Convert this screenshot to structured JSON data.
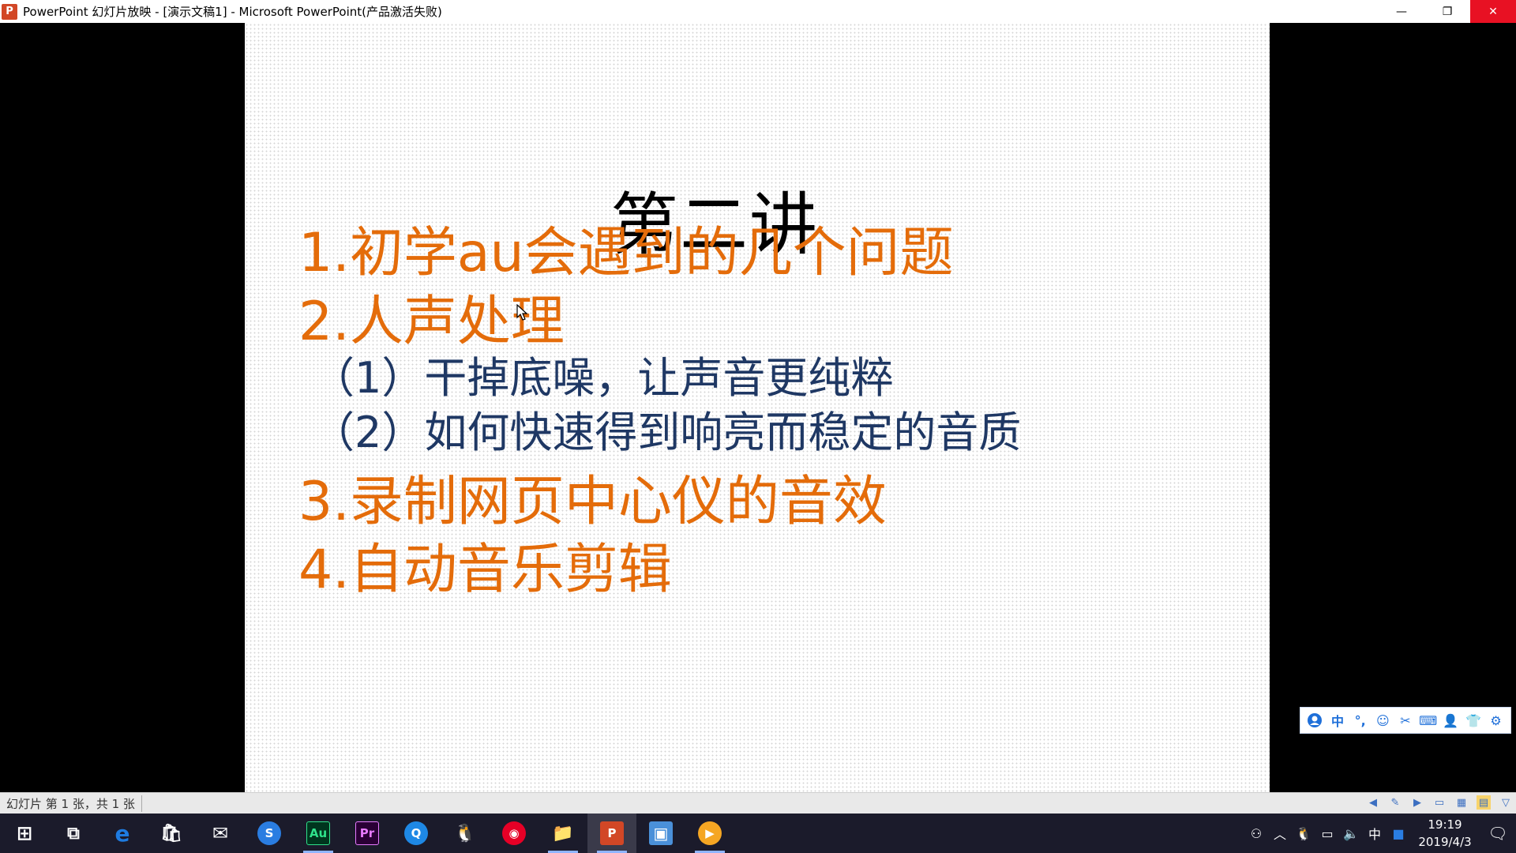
{
  "window": {
    "app_icon_letter": "P",
    "title": "PowerPoint 幻灯片放映 - [演示文稿1] - Microsoft PowerPoint(产品激活失败)",
    "minimize": "—",
    "restore": "❐",
    "close": "✕"
  },
  "slide": {
    "title": "第二讲",
    "items": [
      "1.初学au会遇到的几个问题",
      "2.人声处理",
      "（1）干掉底噪，让声音更纯粹",
      "（2）如何快速得到响亮而稳定的音质",
      "3.录制网页中心仪的音效",
      "4.自动音乐剪辑"
    ],
    "colors": {
      "orange": "#e46c0a",
      "navy": "#1f3864"
    }
  },
  "ime_toolbar": {
    "icons": [
      "user-icon",
      "chinese-mode-icon",
      "punctuation-icon",
      "emoji-icon",
      "scissors-icon",
      "keyboard-icon",
      "person-icon",
      "skin-icon",
      "settings-icon"
    ],
    "mode_label": "中"
  },
  "statusbar": {
    "slide_info": "幻灯片 第 1 张，共 1 张"
  },
  "taskbar": {
    "apps": [
      {
        "name": "start",
        "label": "⊞"
      },
      {
        "name": "task-view",
        "label": "⧉"
      },
      {
        "name": "edge",
        "label": "e"
      },
      {
        "name": "store",
        "label": "🛍"
      },
      {
        "name": "mail",
        "label": "✉"
      },
      {
        "name": "sogou",
        "label": "S"
      },
      {
        "name": "audition",
        "label": "Au"
      },
      {
        "name": "premiere",
        "label": "Pr"
      },
      {
        "name": "browser",
        "label": "Q"
      },
      {
        "name": "qq",
        "label": "🐧"
      },
      {
        "name": "netease-music",
        "label": "◉"
      },
      {
        "name": "file-explorer",
        "label": "📁"
      },
      {
        "name": "powerpoint",
        "label": "P"
      },
      {
        "name": "control-panel",
        "label": "▣"
      },
      {
        "name": "media",
        "label": "▶"
      }
    ],
    "tray_ime": "中",
    "time": "19:19",
    "date": "2019/4/3"
  }
}
